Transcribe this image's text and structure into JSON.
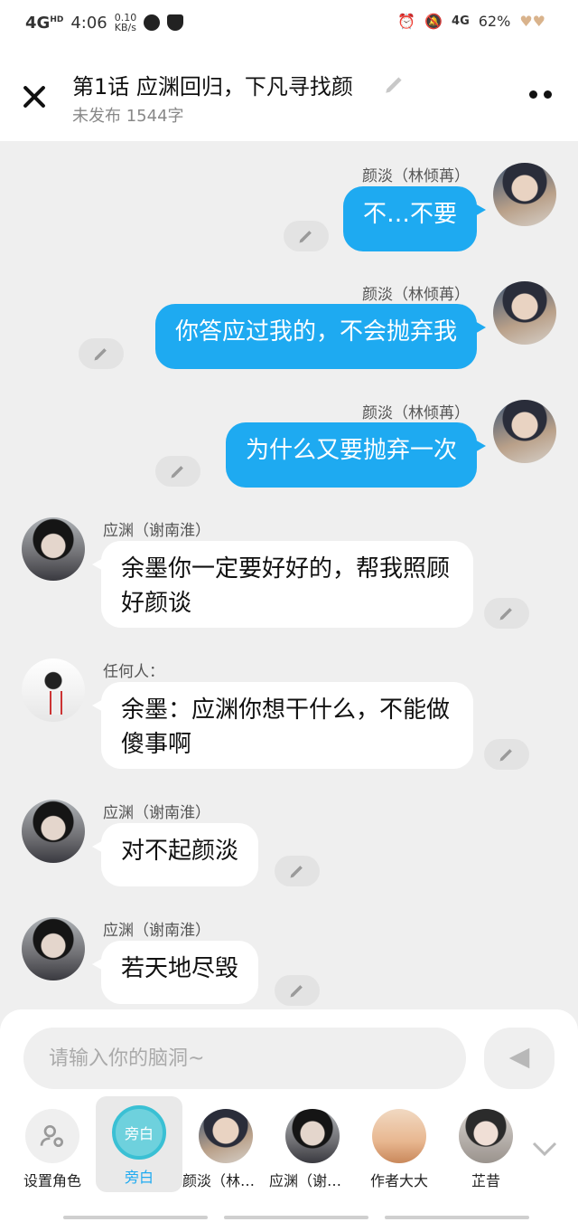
{
  "status_bar": {
    "network": "4G",
    "network_hd": "HD",
    "time": "4:06",
    "speed_value": "0.10",
    "speed_unit": "KB/s",
    "network_right": "4G",
    "battery": "62%"
  },
  "header": {
    "title": "第1话  应渊回归，下凡寻找颜",
    "subtitle": "未发布 1544字"
  },
  "messages": [
    {
      "side": "right",
      "name": "颜淡（林倾苒）",
      "text": "不…不要",
      "avatar": "yan"
    },
    {
      "side": "right",
      "name": "颜淡（林倾苒）",
      "text": "你答应过我的，不会抛弃我",
      "avatar": "yan"
    },
    {
      "side": "right",
      "name": "颜淡（林倾苒）",
      "text": "为什么又要抛弃一次",
      "avatar": "yan"
    },
    {
      "side": "left",
      "name": "应渊（谢南淮）",
      "text": "余墨你一定要好好的，帮我照顾好颜谈",
      "avatar": "ying"
    },
    {
      "side": "left",
      "name": "任何人：",
      "text": "余墨：应渊你想干什么，不能做傻事啊",
      "avatar": "ren"
    },
    {
      "side": "left",
      "name": "应渊（谢南淮）",
      "text": "对不起颜淡",
      "avatar": "ying"
    },
    {
      "side": "left",
      "name": "应渊（谢南淮）",
      "text": "若天地尽毁",
      "avatar": "ying"
    }
  ],
  "composer": {
    "placeholder": "请输入你的脑洞~"
  },
  "roles": [
    {
      "label": "设置角色",
      "icon": "person-settings-icon"
    },
    {
      "label": "旁白",
      "circle_text": "旁白",
      "active": true
    },
    {
      "label": "颜淡（林倾苒）"
    },
    {
      "label": "应渊（谢南淮）"
    },
    {
      "label": "作者大大"
    },
    {
      "label": "芷昔"
    }
  ],
  "colors": {
    "accent": "#1eaaf1",
    "narrator": "#3ac0d4"
  }
}
